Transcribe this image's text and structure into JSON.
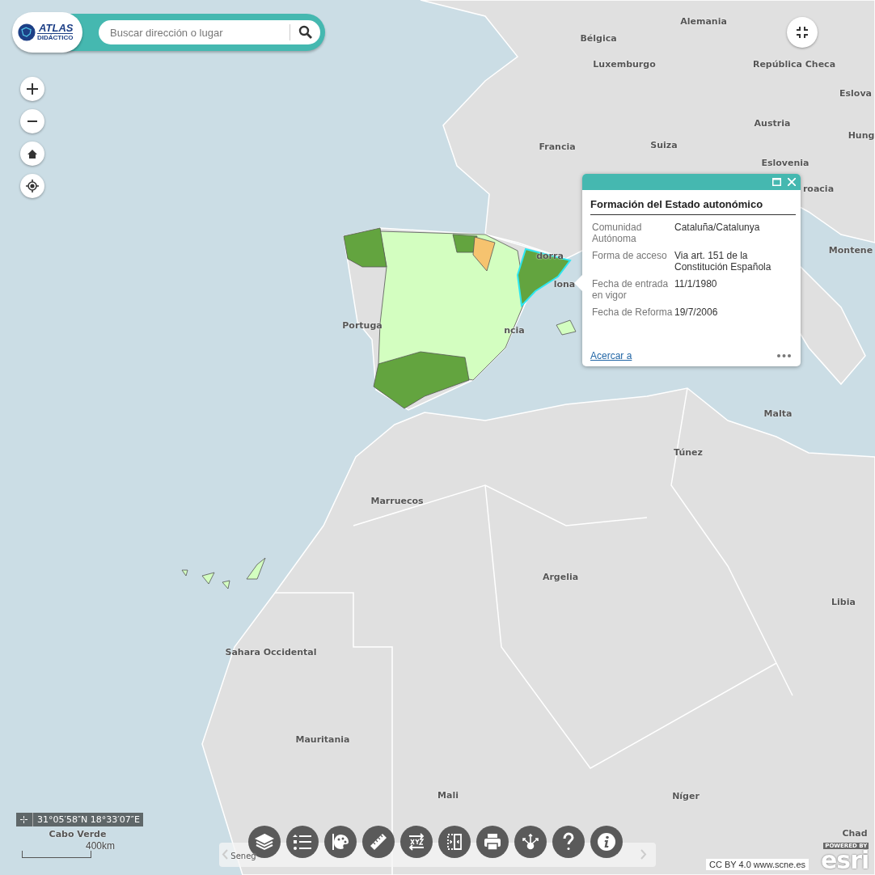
{
  "logo": {
    "title": "ATLAS",
    "subtitle": "DIDÁCTICO"
  },
  "search": {
    "placeholder": "Buscar dirección o lugar"
  },
  "map_labels": [
    "Alemania",
    "Bélgica",
    "Luxemburgo",
    "República Checa",
    "Eslova",
    "Austria",
    "Hung",
    "Francia",
    "Suiza",
    "Eslovenia",
    "roacia",
    "Montene",
    "dorra",
    "lona",
    "Portuga",
    "ncia",
    "Malta",
    "Túnez",
    "Marruecos",
    "Argelia",
    "Libia",
    "Sahara Occidental",
    "Mauritania",
    "Mali",
    "Níger",
    "Chad",
    "Cabo Verde",
    "Seneg"
  ],
  "popup": {
    "title": "Formación del Estado autonómico",
    "fields": [
      {
        "label": "Comunidad Autónoma",
        "value": "Cataluña/Catalunya"
      },
      {
        "label": "Forma de acceso",
        "value": "Via art. 151 de la Constitución Española"
      },
      {
        "label": "Fecha de entrada en vigor",
        "value": "11/1/1980"
      },
      {
        "label": "Fecha de Reforma",
        "value": "19/7/2006"
      }
    ],
    "zoom_link": "Acercar a"
  },
  "coordinates": "31°05′58″N 18°33′07″E",
  "scale": "400km",
  "toolbar": [
    {
      "kind": "layers"
    },
    {
      "kind": "legend"
    },
    {
      "kind": "palette"
    },
    {
      "kind": "ruler"
    },
    {
      "kind": "xyz"
    },
    {
      "kind": "swipe"
    },
    {
      "kind": "print"
    },
    {
      "kind": "share"
    },
    {
      "kind": "help"
    },
    {
      "kind": "info"
    }
  ],
  "attribution": "CC BY 4.0 www.scne.es",
  "esri": {
    "top": "POWERED BY",
    "brand": "esri"
  }
}
